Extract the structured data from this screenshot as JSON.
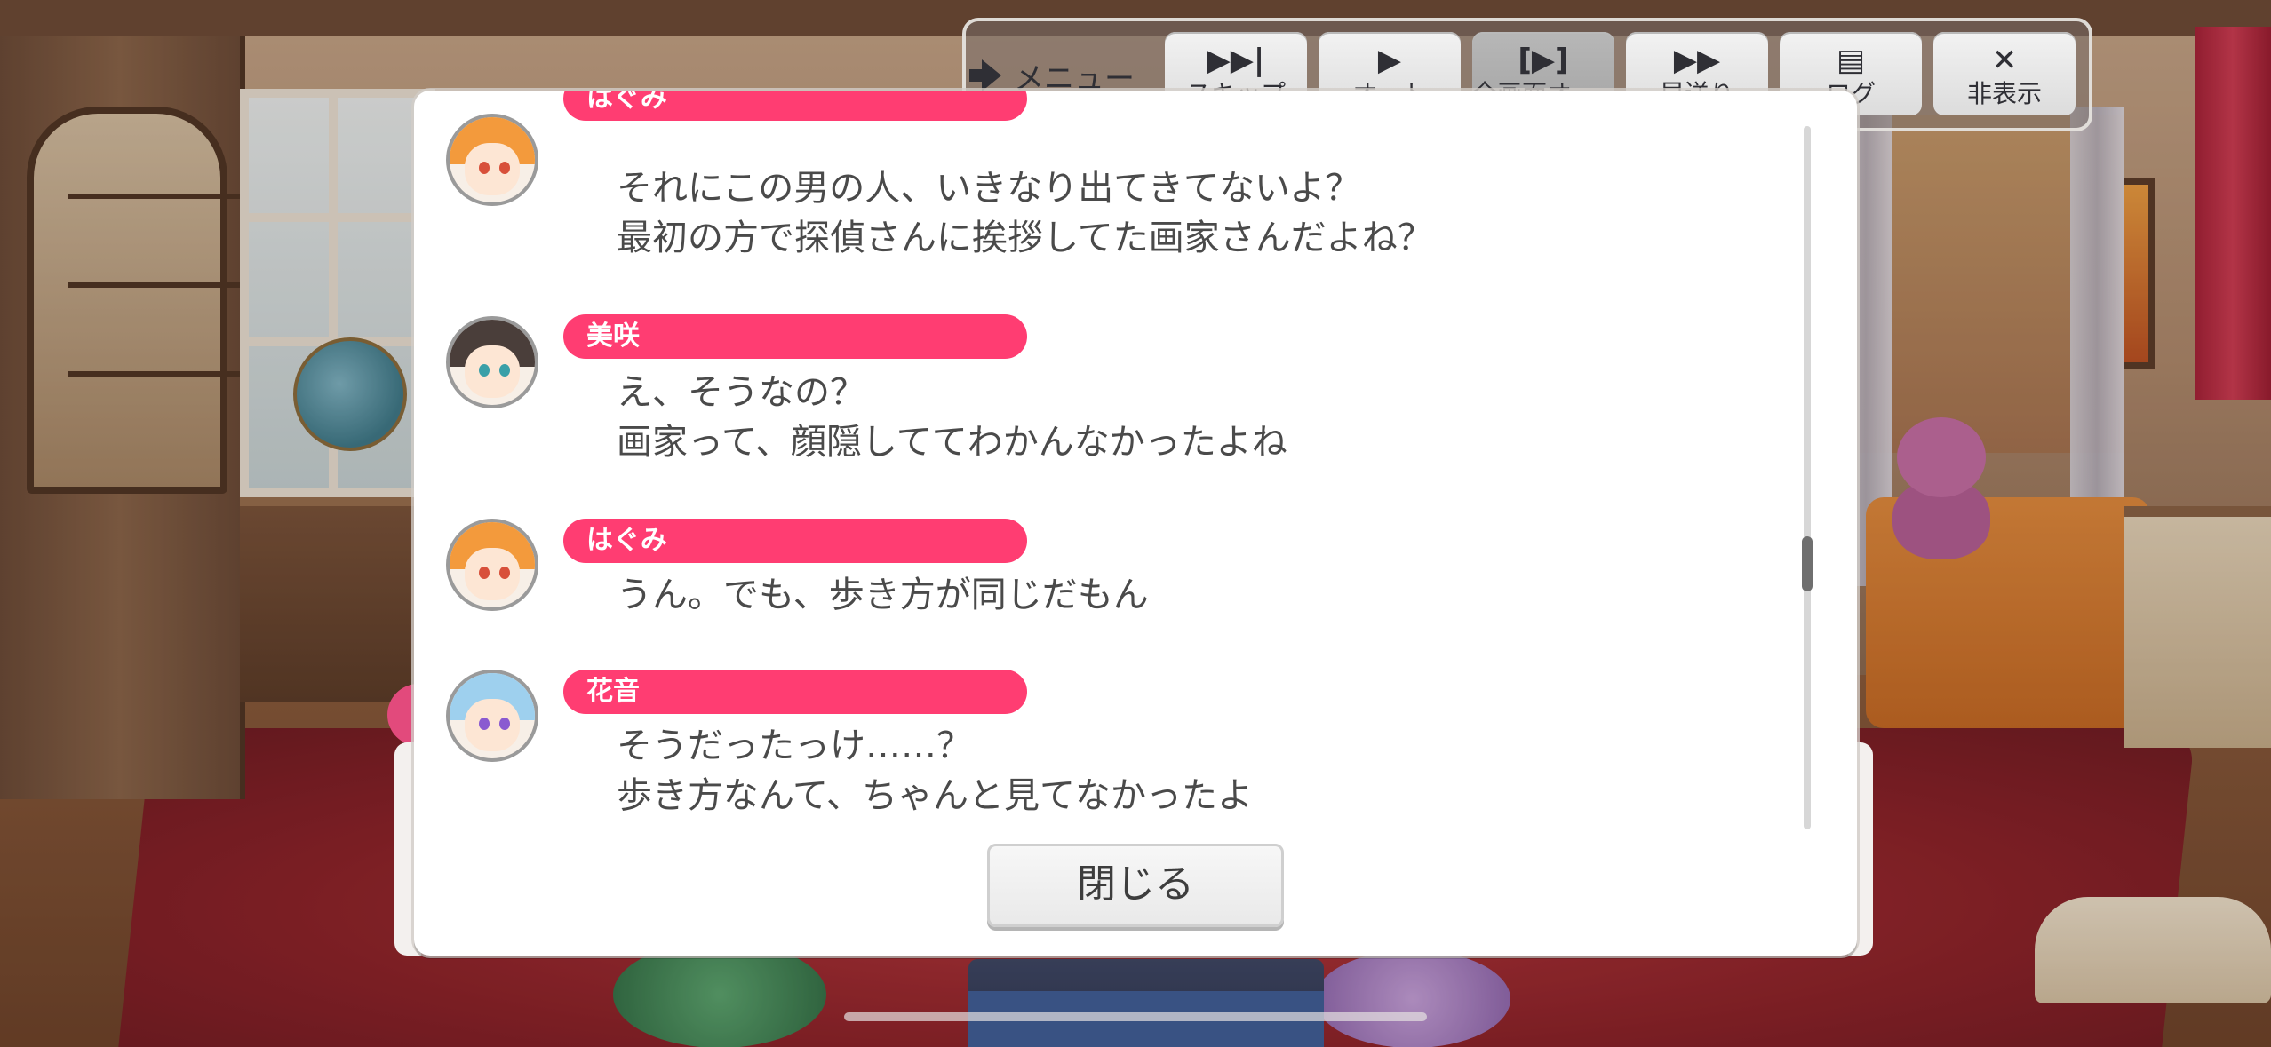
{
  "topbar": {
    "menu_label": "メニュー",
    "buttons": [
      {
        "label": "スキップ",
        "icon": "skip-icon",
        "active": false
      },
      {
        "label": "オート",
        "icon": "play-icon",
        "active": false
      },
      {
        "label": "全画面オート",
        "icon": "fullscreen-auto-icon",
        "active": true
      },
      {
        "label": "早送り",
        "icon": "fast-forward-icon",
        "active": false
      },
      {
        "label": "ログ",
        "icon": "log-icon",
        "active": false
      },
      {
        "label": "非表示",
        "icon": "close-icon",
        "active": false
      }
    ]
  },
  "log": {
    "entries": [
      {
        "speaker": "はぐみ",
        "lines": [
          "それにこの男の人、いきなり出てきてないよ？",
          "最初の方で探偵さんに挨拶してた画家さんだよね？"
        ]
      },
      {
        "speaker": "美咲",
        "lines": [
          "え、そうなの？",
          "画家って、顔隠しててわかんなかったよね"
        ]
      },
      {
        "speaker": "はぐみ",
        "lines": [
          "うん。でも、歩き方が同じだもん"
        ]
      },
      {
        "speaker": "花音",
        "lines": [
          "そうだったっけ……？",
          "歩き方なんて、ちゃんと見てなかったよ"
        ]
      }
    ],
    "close_label": "閉じる"
  },
  "colors": {
    "name_tag": "#ff3d72",
    "text": "#4a4a4a",
    "hagumi_hair": "#f39a3c",
    "misaki_hair": "#4a3e3a",
    "kanon_hair": "#9ed0ee"
  }
}
